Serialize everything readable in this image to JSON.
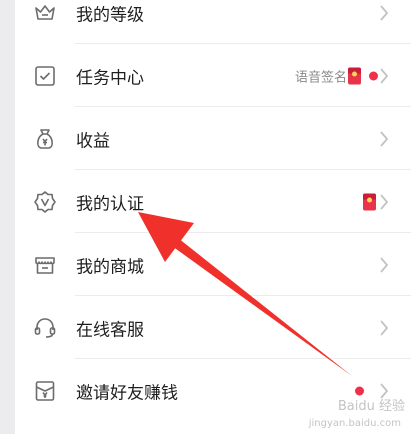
{
  "colors": {
    "accent_red": "#f0304a",
    "arrow_red": "#f0302a",
    "icon_gray": "#6c6c6c",
    "chevron_gray": "#c2c2c2"
  },
  "menu": {
    "items": [
      {
        "label": "我的等级",
        "icon": "crown-icon"
      },
      {
        "label": "任务中心",
        "icon": "checkbox-icon",
        "sub": "语音签名",
        "has_envelope": true,
        "has_dot": true
      },
      {
        "label": "收益",
        "icon": "money-bag-icon"
      },
      {
        "label": "我的认证",
        "icon": "verified-badge-icon",
        "has_envelope": true
      },
      {
        "label": "我的商城",
        "icon": "store-icon"
      },
      {
        "label": "在线客服",
        "icon": "headset-icon"
      },
      {
        "label": "邀请好友赚钱",
        "icon": "invite-envelope-icon",
        "has_dot": true
      }
    ]
  },
  "annotation": {
    "type": "arrow",
    "points_to": "我的认证"
  },
  "watermark": {
    "line1": "Baidu 经验",
    "line2": "jingyan.baidu.com"
  }
}
